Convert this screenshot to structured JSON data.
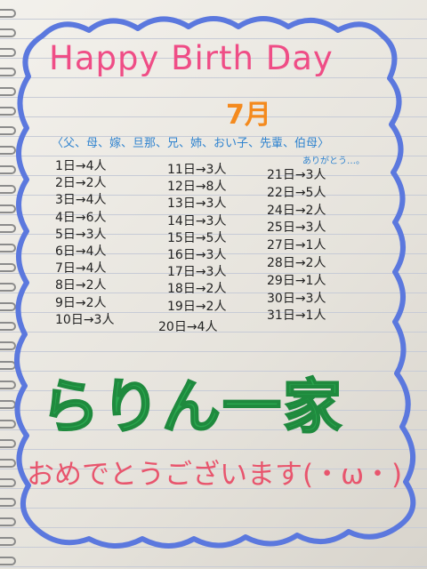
{
  "title": "Happy Birth Day",
  "month": "7月",
  "audience": "〈父、母、嫁、旦那、兄、姉、おい子、先輩、伯母〉",
  "note": "ありがとう…。",
  "days": {
    "col1": [
      "1日→4人",
      "2日→2人",
      "3日→4人",
      "4日→6人",
      "5日→3人",
      "6日→4人",
      "7日→4人",
      "8日→2人",
      "9日→2人",
      "10日→3人"
    ],
    "col2": [
      "11日→3人",
      "12日→8人",
      "13日→3人",
      "14日→3人",
      "15日→5人",
      "16日→3人",
      "17日→3人",
      "18日→2人",
      "19日→2人",
      "20日→4人"
    ],
    "col3": [
      "21日→3人",
      "22日→5人",
      "24日→2人",
      "25日→3人",
      "27日→1人",
      "28日→2人",
      "29日→1人",
      "30日→3人",
      "31日→1人"
    ]
  },
  "family": "らりん一家",
  "greeting": "おめでとうございます(・ω・)",
  "colors": {
    "frame": "#5b78de",
    "title": "#ef4d86",
    "month": "#f48a1e",
    "audience": "#2f83cf",
    "family": "#2aa84f",
    "greeting": "#e8556d"
  }
}
